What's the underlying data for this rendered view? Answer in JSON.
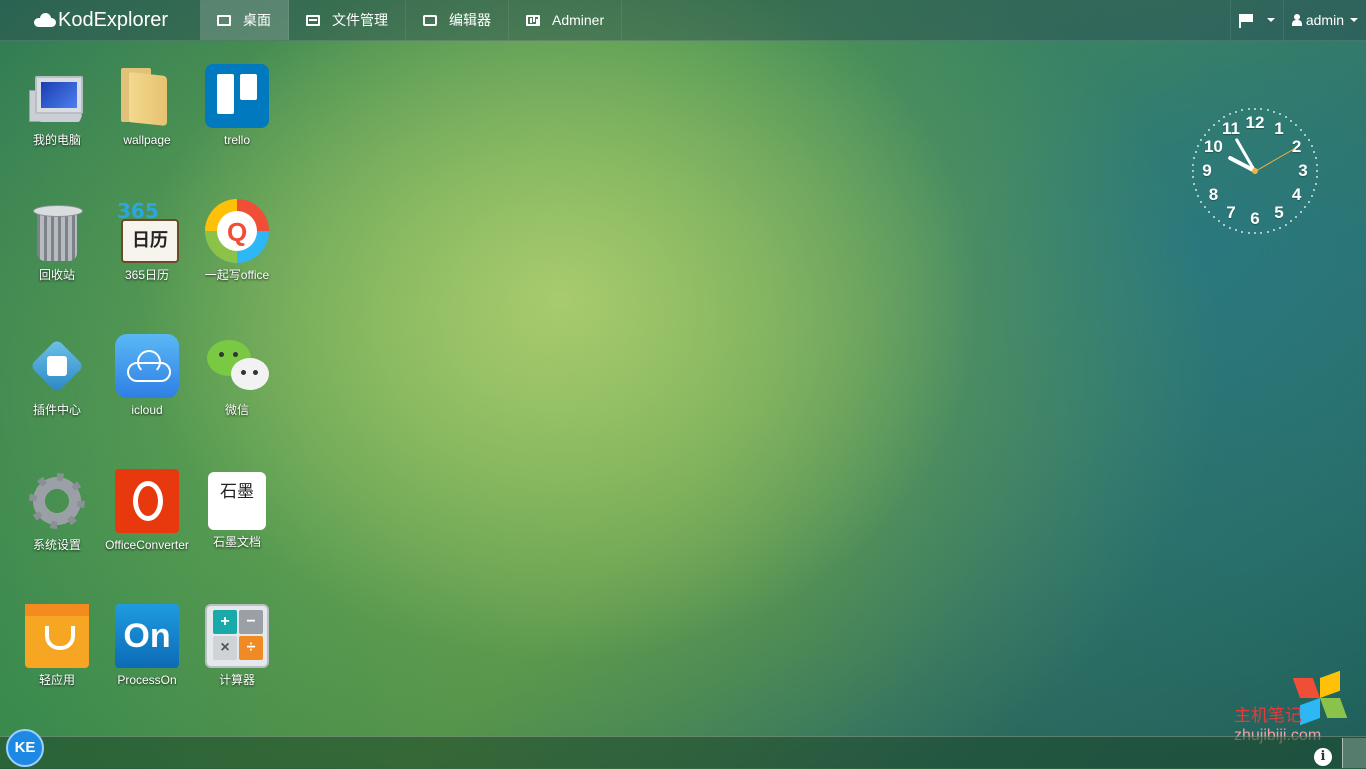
{
  "app": {
    "brand": "KodExplorer"
  },
  "nav": {
    "items": [
      {
        "label": "桌面",
        "icon": "monitor-icon",
        "active": true
      },
      {
        "label": "文件管理",
        "icon": "file-manager-icon"
      },
      {
        "label": "编辑器",
        "icon": "edit-icon"
      },
      {
        "label": "Adminer",
        "icon": "chart-icon"
      }
    ],
    "user": "admin",
    "flag_icon": "flag-icon"
  },
  "desktop": {
    "icons": [
      {
        "label": "我的电脑"
      },
      {
        "label": "wallpage"
      },
      {
        "label": "trello"
      },
      {
        "label": "回收站"
      },
      {
        "label": "365日历",
        "art": "日历",
        "art_nums": "365"
      },
      {
        "label": "一起写office",
        "art": "Q"
      },
      {
        "label": "插件中心"
      },
      {
        "label": "icloud"
      },
      {
        "label": "微信"
      },
      {
        "label": "系统设置"
      },
      {
        "label": "OfficeConverter"
      },
      {
        "label": "石墨文档",
        "art": "石墨"
      },
      {
        "label": "轻应用"
      },
      {
        "label": "ProcessOn",
        "art": "On"
      },
      {
        "label": "计算器",
        "art": [
          "+",
          "−",
          "×",
          "÷"
        ]
      }
    ]
  },
  "clock": {
    "numbers": [
      "12",
      "1",
      "2",
      "3",
      "4",
      "5",
      "6",
      "7",
      "8",
      "9",
      "10",
      "11"
    ],
    "time": {
      "hour": 9,
      "minute": 55,
      "second": 10
    }
  },
  "taskbar": {
    "start_label": "KE",
    "info_label": "i"
  },
  "watermark": {
    "line1": "主机笔记",
    "line2": "zhujibiji.com"
  },
  "colors": {
    "accent": "#1e88e5",
    "watermark": "#e83a3a"
  }
}
